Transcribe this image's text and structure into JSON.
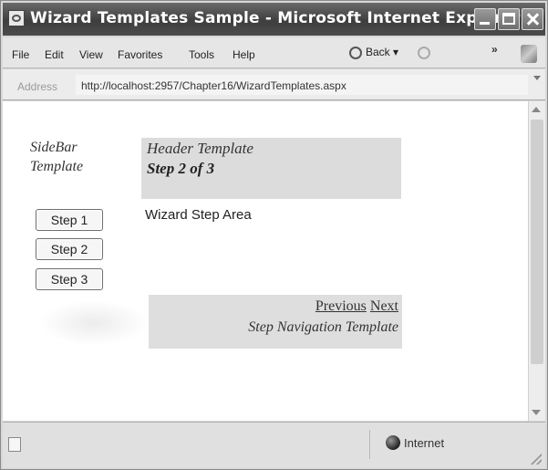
{
  "window": {
    "title": "Wizard Templates Sample - Microsoft Internet Explorer"
  },
  "menu": {
    "items": [
      "File",
      "Edit",
      "View",
      "Favorites",
      "Tools",
      "Help"
    ],
    "back_label": "Back",
    "overflow_label": "»"
  },
  "address": {
    "label": "Address",
    "url": "http://localhost:2957/Chapter16/WizardTemplates.aspx"
  },
  "page": {
    "sidebar_template": [
      "SideBar",
      "Template"
    ],
    "steps": [
      "Step 1",
      "Step 2",
      "Step 3"
    ],
    "header_template_label": "Header Template",
    "header_step_text": "Step 2 of 3",
    "wizard_step_area": "Wizard Step Area",
    "nav_previous": "Previous",
    "nav_next": "Next",
    "nav_template_label": "Step Navigation Template"
  },
  "status": {
    "zone": "Internet"
  },
  "icons": {
    "app": "ie-page-icon",
    "back": "back-arrow-icon",
    "forward": "forward-arrow-icon",
    "status_page": "page-done-icon",
    "zone": "globe-icon"
  }
}
